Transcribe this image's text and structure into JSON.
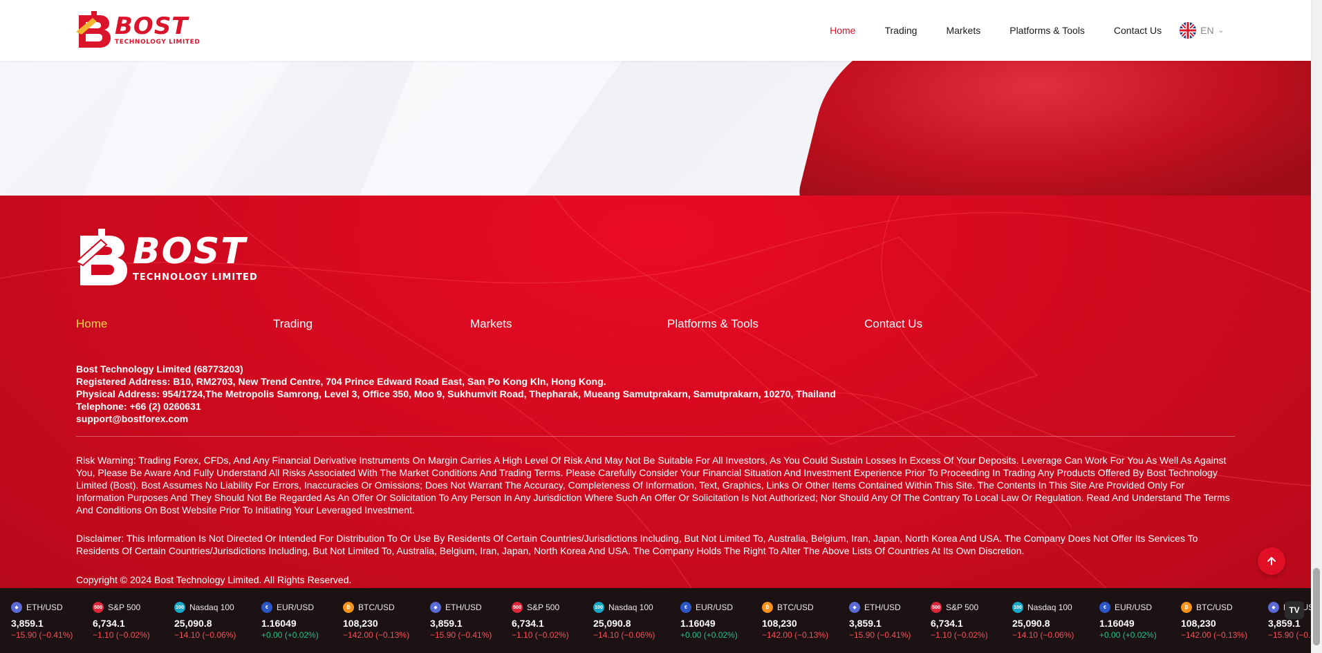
{
  "header": {
    "logo_word": "BOST",
    "logo_sub": "TECHNOLOGY LIMITED",
    "nav": [
      {
        "label": "Home",
        "active": true
      },
      {
        "label": "Trading",
        "active": false
      },
      {
        "label": "Markets",
        "active": false
      },
      {
        "label": "Platforms & Tools",
        "active": false
      },
      {
        "label": "Contact Us",
        "active": false
      }
    ],
    "language": "EN"
  },
  "footer": {
    "logo_word": "BOST",
    "logo_sub": "TECHNOLOGY LIMITED",
    "nav": [
      {
        "label": "Home",
        "active": true
      },
      {
        "label": "Trading",
        "active": false
      },
      {
        "label": "Markets",
        "active": false
      },
      {
        "label": "Platforms & Tools",
        "active": false
      },
      {
        "label": "Contact Us",
        "active": false
      }
    ],
    "company_name": "Bost Technology Limited (68773203)",
    "registered_address": "Registered Address: B10, RM2703, New Trend Centre, 704 Prince Edward Road East, San Po Kong Kln, Hong Kong.",
    "physical_address": "Physical Address: 954/1724,The Metropolis Samrong, Level 3, Office 350, Moo 9, Sukhumvit Road, Thepharak, Mueang Samutprakarn, Samutprakarn, 10270, Thailand",
    "telephone": "Telephone: +66 (2) 0260631",
    "email": "support@bostforex.com",
    "risk_warning": "Risk Warning: Trading Forex, CFDs, And Any Financial Derivative Instruments On Margin Carries A High Level Of Risk And May Not Be Suitable For All Investors, As You Could Sustain Losses In Excess Of Your Deposits. Leverage Can Work For You As Well As Against You, Please Be Aware And Fully Understand All Risks Associated With The Market Conditions And Trading Terms. Please Carefully Consider Your Financial Situation And Investment Experience Prior To Proceeding In Trading Any Products Offered By Bost Technology Limited (Bost). Bost Assumes No Liability For Errors, Inaccuracies Or Omissions; Does Not Warrant The Accuracy, Completeness Of Information, Text, Graphics, Links Or Other Items Contained Within This Site. The Contents In This Site Are Provided Only For Information Purposes And They Should Not Be Regarded As An Offer Or Solicitation To Any Person In Any Jurisdiction Where Such An Offer Or Solicitation Is Not Authorized; Nor Should Any Of The Contrary To Local Law Or Regulation. Read And Understand The Terms And Conditions On Bost Website Prior To Initiating Your Leveraged Investment.",
    "disclaimer": "Disclaimer: This Information Is Not Directed Or Intended For Distribution To Or Use By Residents Of Certain Countries/Jurisdictions Including, But Not Limited To, Australia, Belgium, Iran, Japan, North Korea And USA. The Company Does Not Offer Its Services To Residents Of Certain Countries/Jurisdictions Including, But Not Limited To, Australia, Belgium, Iran, Japan, North Korea And USA. The Company Holds The Right To Alter The Above Lists Of Countries At Its Own Discretion.",
    "copyright": "Copyright © 2024 Bost Technology Limited. All Rights Reserved."
  },
  "ticker": {
    "items": [
      {
        "symbol": "BTC/USD",
        "icon": "bitcoin-icon",
        "glyph": "₿",
        "cls": "ico-btc",
        "value": "108,230",
        "change": "−142.00 (−0.13%)",
        "dir": "neg"
      },
      {
        "symbol": "ETH/USD",
        "icon": "ethereum-icon",
        "glyph": "◆",
        "cls": "ico-eth",
        "value": "3,859.1",
        "change": "−15.90 (−0.41%)",
        "dir": "neg"
      },
      {
        "symbol": "S&P 500",
        "icon": "sp500-icon",
        "glyph": "500",
        "cls": "ico-spx",
        "value": "6,734.1",
        "change": "−1.10 (−0.02%)",
        "dir": "neg"
      },
      {
        "symbol": "Nasdaq 100",
        "icon": "nasdaq-icon",
        "glyph": "100",
        "cls": "ico-ndx",
        "value": "25,090.8",
        "change": "−14.10 (−0.06%)",
        "dir": "neg"
      },
      {
        "symbol": "EUR/USD",
        "icon": "eur-usd-flag-icon",
        "glyph": "€",
        "cls": "ico-eur",
        "value": "1.16049",
        "change": "+0.00 (+0.02%)",
        "dir": "pos"
      }
    ],
    "tv_label": "TV"
  },
  "colors": {
    "brand_red": "#d9142b",
    "footer_active": "#ffd54a",
    "ticker_bg": "#1c1214",
    "ticker_neg": "#f2525a",
    "ticker_pos": "#1fc28d"
  }
}
